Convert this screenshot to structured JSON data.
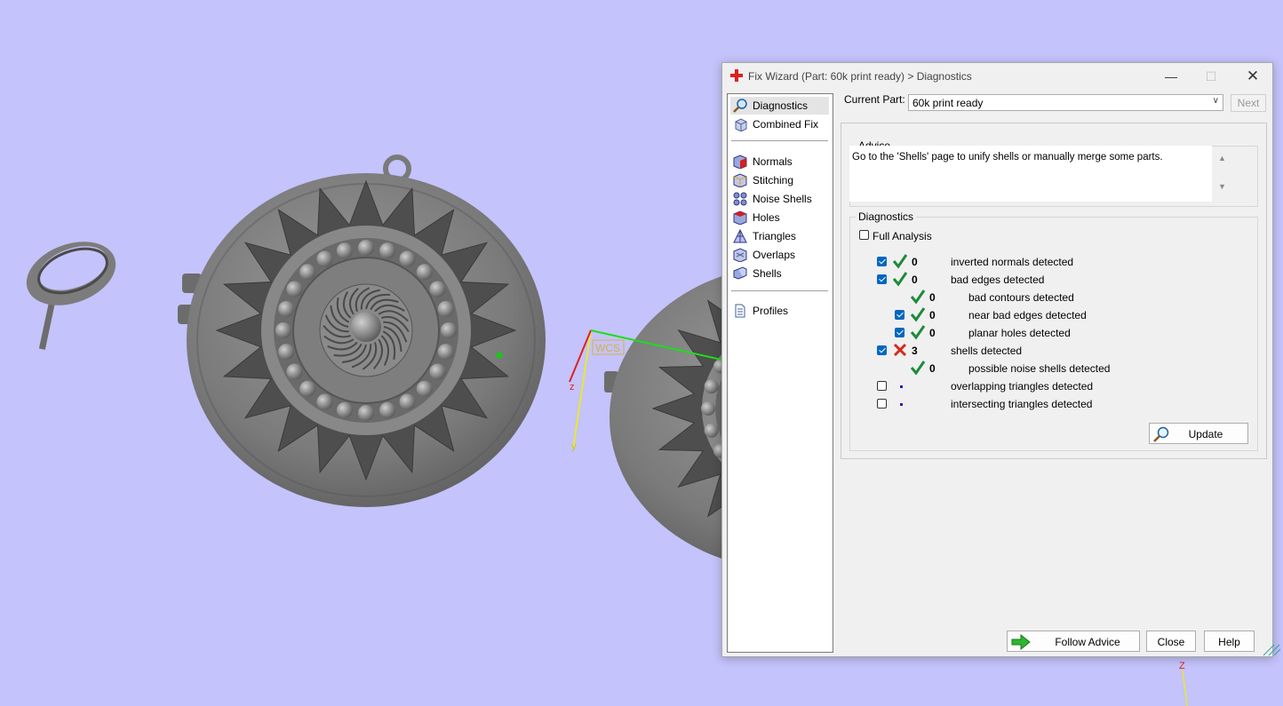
{
  "viewport": {
    "background": "#c4c3fb",
    "wcs_label": "WCS",
    "axis_z": "z",
    "axis_y": "y",
    "corner_axis_z": "Z"
  },
  "dialog": {
    "title": "Fix Wizard (Part: 60k print ready) > Diagnostics",
    "icon": "red-cross-icon",
    "controls": {
      "minimize": "—",
      "maximize": "☐",
      "close": "✕"
    }
  },
  "sidebar": {
    "top_items": [
      {
        "label": "Diagnostics",
        "icon": "magnifier-icon",
        "selected": true
      },
      {
        "label": "Combined Fix",
        "icon": "cube-icon"
      }
    ],
    "fix_items": [
      {
        "label": "Normals",
        "icon": "normals-cube-icon"
      },
      {
        "label": "Stitching",
        "icon": "stitching-cube-icon"
      },
      {
        "label": "Noise Shells",
        "icon": "noise-shells-icon"
      },
      {
        "label": "Holes",
        "icon": "holes-cube-icon"
      },
      {
        "label": "Triangles",
        "icon": "triangles-icon"
      },
      {
        "label": "Overlaps",
        "icon": "overlaps-icon"
      },
      {
        "label": "Shells",
        "icon": "shells-icon"
      }
    ],
    "bottom_items": [
      {
        "label": "Profiles",
        "icon": "document-icon"
      }
    ]
  },
  "current_part": {
    "label": "Current Part:",
    "value": "60k print ready",
    "next_label": "Next"
  },
  "advice": {
    "title": "Advice",
    "text": "Go to the 'Shells' page to unify shells or manually merge some parts."
  },
  "diagnostics": {
    "title": "Diagnostics",
    "full_analysis_label": "Full Analysis",
    "full_analysis_checked": false,
    "rows": [
      {
        "checked": true,
        "status": "ok",
        "count": "0",
        "label": "inverted normals detected"
      },
      {
        "checked": true,
        "status": "ok",
        "count": "0",
        "label": "bad edges detected"
      },
      {
        "checked": null,
        "status": "ok",
        "count": "0",
        "label": "bad contours detected",
        "indent": true
      },
      {
        "checked": true,
        "status": "ok",
        "count": "0",
        "label": "near bad edges detected",
        "indent": true
      },
      {
        "checked": true,
        "status": "ok",
        "count": "0",
        "label": "planar holes detected",
        "indent": true
      },
      {
        "checked": true,
        "status": "fail",
        "count": "3",
        "label": "shells detected"
      },
      {
        "checked": null,
        "status": "ok",
        "count": "0",
        "label": "possible noise shells detected",
        "indent": true
      },
      {
        "checked": false,
        "status": "none",
        "count": "",
        "label": "overlapping triangles detected"
      },
      {
        "checked": false,
        "status": "none",
        "count": "",
        "label": "intersecting triangles detected"
      }
    ],
    "update_label": "Update"
  },
  "footer": {
    "follow_advice_label": "Follow Advice",
    "close_label": "Close",
    "help_label": "Help"
  },
  "colors": {
    "ok_check": "#1e8a3a",
    "fail_cross": "#d42a1e",
    "checkbox_checked": "#0067c0",
    "follow_arrow": "#2fb52f"
  }
}
